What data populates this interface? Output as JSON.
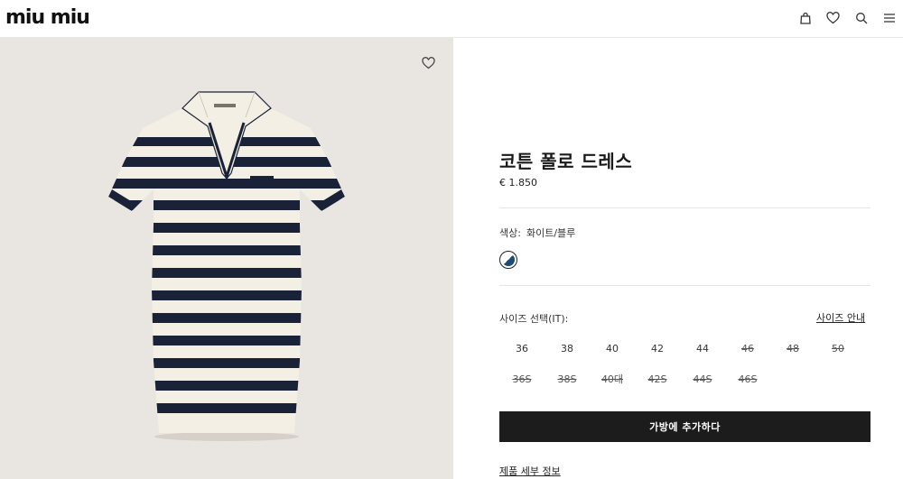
{
  "header": {
    "logo": "miu miu",
    "icons": [
      "bag-icon",
      "heart-icon",
      "search-icon",
      "menu-icon"
    ]
  },
  "product": {
    "title": "코튼 폴로 드레스",
    "price": "€ 1.850",
    "color_label": "색상:",
    "color_value": "화이트/블루",
    "size_label": "사이즈 선택(IT):",
    "size_guide": "사이즈 안내",
    "sizes_row1": [
      {
        "label": "36",
        "available": true
      },
      {
        "label": "38",
        "available": true
      },
      {
        "label": "40",
        "available": true
      },
      {
        "label": "42",
        "available": true
      },
      {
        "label": "44",
        "available": true
      },
      {
        "label": "46",
        "available": false
      },
      {
        "label": "48",
        "available": false
      },
      {
        "label": "50",
        "available": false
      }
    ],
    "sizes_row2": [
      {
        "label": "36S",
        "available": false
      },
      {
        "label": "38S",
        "available": false
      },
      {
        "label": "40대",
        "available": false
      },
      {
        "label": "42S",
        "available": false
      },
      {
        "label": "44S",
        "available": false
      },
      {
        "label": "46S",
        "available": false
      }
    ],
    "add_to_bag": "가방에 추가하다",
    "details": "제품 세부 정보"
  },
  "colors": {
    "background_image": "#e9e5e0",
    "button": "#1c1c1c",
    "stripe": "#1a2238",
    "knit": "#f4efe4"
  }
}
